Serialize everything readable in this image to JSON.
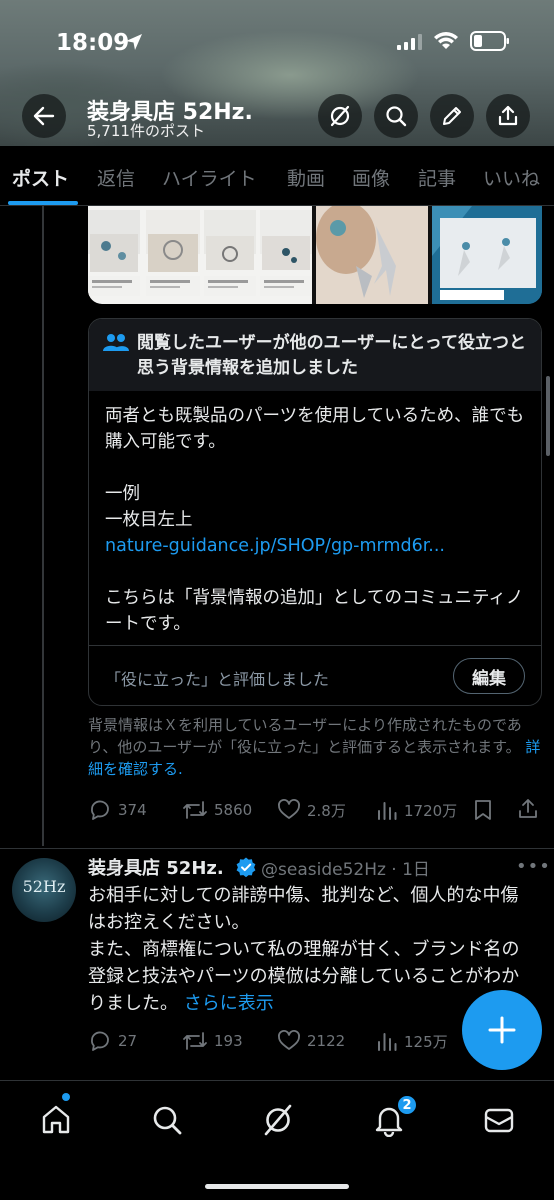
{
  "status_bar": {
    "time": "18:09"
  },
  "header": {
    "account_name": "装身具店 52Hz.",
    "post_count": "5,711件のポスト"
  },
  "tabs": [
    {
      "label": "ポスト",
      "active": true
    },
    {
      "label": "返信"
    },
    {
      "label": "ハイライト"
    },
    {
      "label": "動画"
    },
    {
      "label": "画像"
    },
    {
      "label": "記事"
    },
    {
      "label": "いいね"
    }
  ],
  "community_note": {
    "title": "閲覧したユーザーが他のユーザーにとって役立つと思う背景情報を追加しました",
    "body_line1": "両者とも既製品のパーツを使用しているため、誰でも購入可能です。",
    "body_line2": "一例",
    "body_line3": "一枚目左上",
    "link": "nature-guidance.jp/SHOP/gp-mrmd6r...",
    "body_line4": "こちらは「背景情報の追加」としてのコミュニティノートです。",
    "rated_text": "「役に立った」と評価しました",
    "edit_label": "編集",
    "disclaimer": "背景情報はＸを利用しているユーザーにより作成されたものであり、他のユーザーが「役に立った」と評価すると表示されます。",
    "details_link": "詳細を確認する."
  },
  "post1_actions": {
    "replies": "374",
    "reposts": "5860",
    "likes": "2.8万",
    "views": "1720万"
  },
  "post2": {
    "avatar_text": "52Hz",
    "name": "装身具店 52Hz.",
    "handle_time": "@seaside52Hz · 1日",
    "text": "お相手に対しての誹謗中傷、批判など、個人的な中傷はお控えください。\nまた、商標権について私の理解が甘く、ブランド名の登録と技法やパーツの模倣は分離していることがわかりました。",
    "more_label": "さらに表示",
    "replies": "27",
    "reposts": "193",
    "likes": "2122",
    "views": "125万"
  },
  "bottom_nav": {
    "notifications_badge": "2"
  },
  "colors": {
    "accent": "#1d9bf0",
    "background": "#000000",
    "muted": "#71767b"
  }
}
